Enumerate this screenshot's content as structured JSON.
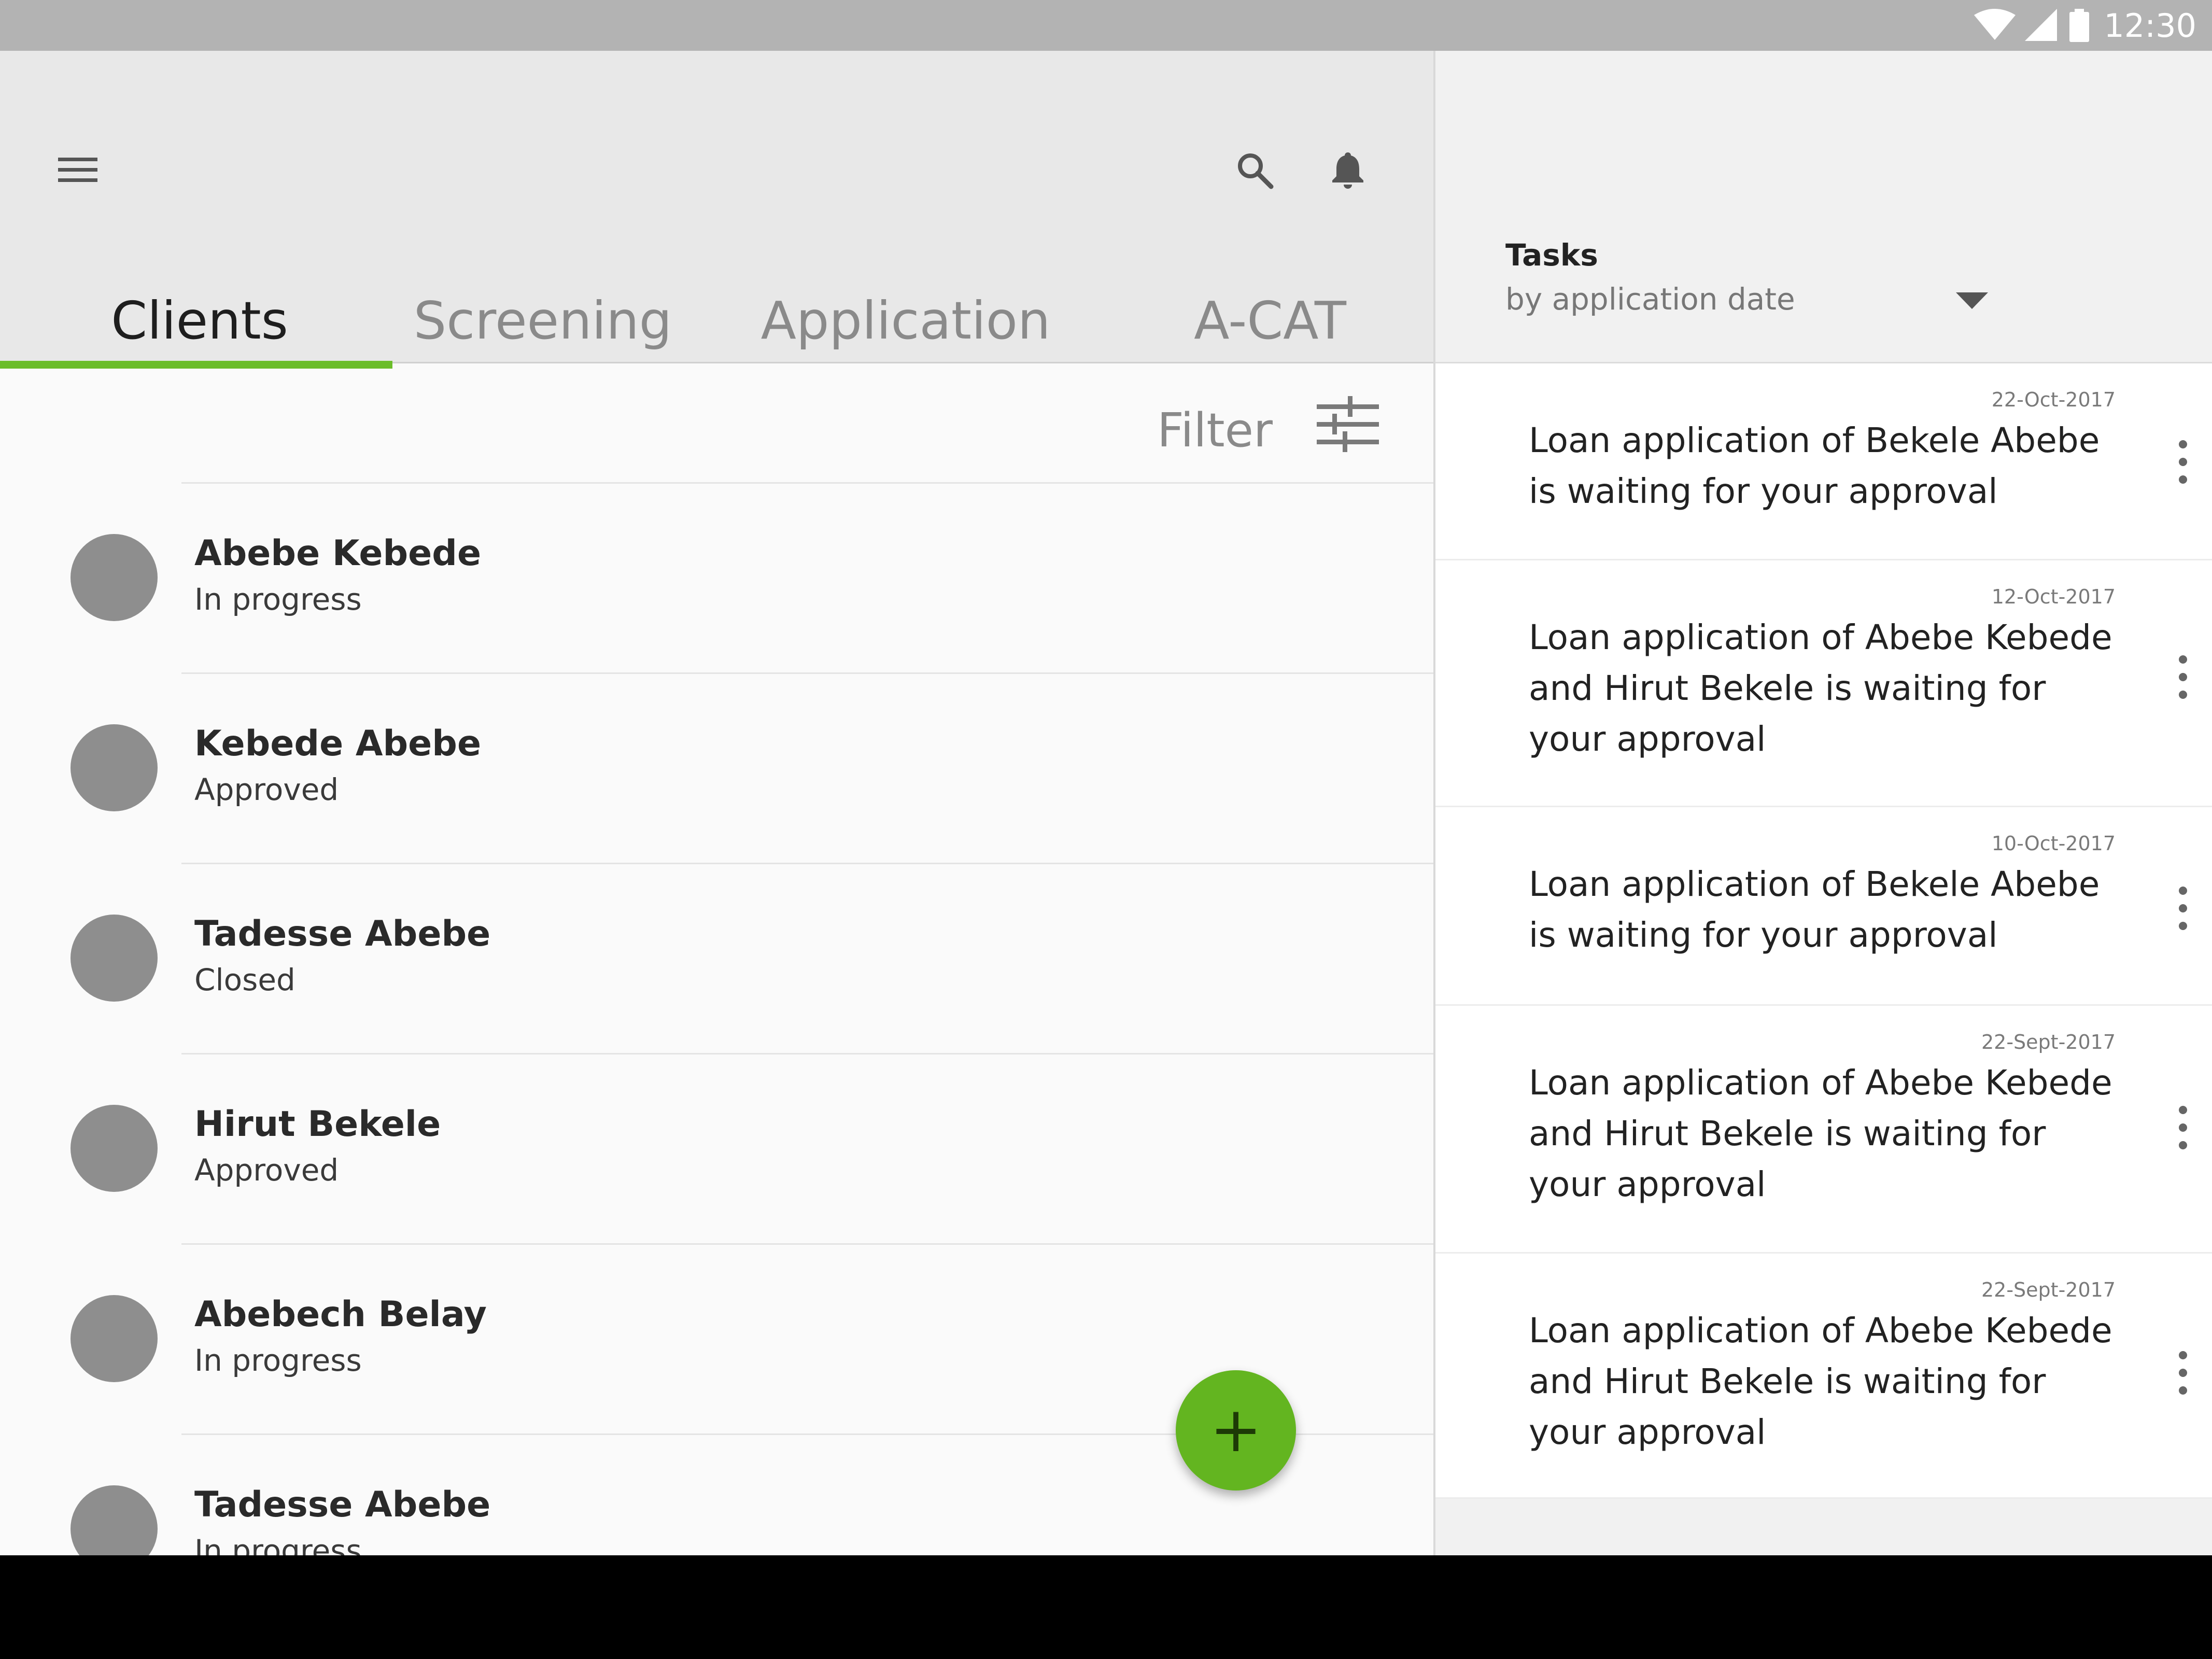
{
  "status_bar": {
    "time": "12:30",
    "icons": [
      "wifi-icon",
      "cell-signal-icon",
      "battery-icon"
    ]
  },
  "header": {
    "icons": [
      "menu-icon",
      "search-icon",
      "bell-icon"
    ]
  },
  "tabs": [
    {
      "label": "Clients",
      "active": true
    },
    {
      "label": "Screening",
      "active": false
    },
    {
      "label": "Application",
      "active": false
    },
    {
      "label": "A-CAT",
      "active": false
    }
  ],
  "filter": {
    "label": "Filter",
    "icon": "tune-icon"
  },
  "clients": [
    {
      "name": "Abebe Kebede",
      "status": "In progress"
    },
    {
      "name": "Kebede Abebe",
      "status": "Approved"
    },
    {
      "name": "Tadesse Abebe",
      "status": "Closed"
    },
    {
      "name": "Hirut Bekele",
      "status": "Approved"
    },
    {
      "name": "Abebech Belay",
      "status": "In progress"
    },
    {
      "name": "Tadesse Abebe",
      "status": "In progress"
    }
  ],
  "fab": {
    "label": "+"
  },
  "tasks": {
    "title": "Tasks",
    "sort_label": "by application date",
    "items": [
      {
        "date": "22-Oct-2017",
        "text": "Loan application of Bekele Abebe is waiting for your approval"
      },
      {
        "date": "12-Oct-2017",
        "text": "Loan application of Abebe Kebede and Hirut Bekele is waiting for your approval"
      },
      {
        "date": "10-Oct-2017",
        "text": "Loan application of Bekele Abebe is waiting for your approval"
      },
      {
        "date": "22-Sept-2017",
        "text": "Loan application of Abebe Kebede and Hirut Bekele is waiting for your approval"
      },
      {
        "date": "22-Sept-2017",
        "text": "Loan application of Abebe Kebede and Hirut Bekele is waiting for your approval"
      }
    ]
  },
  "colors": {
    "accent": "#6bbd2a",
    "fab": "#63b520",
    "status_bar": "#b3b3b3",
    "header": "#e8e8e8",
    "avatar": "#8e8e8e"
  }
}
